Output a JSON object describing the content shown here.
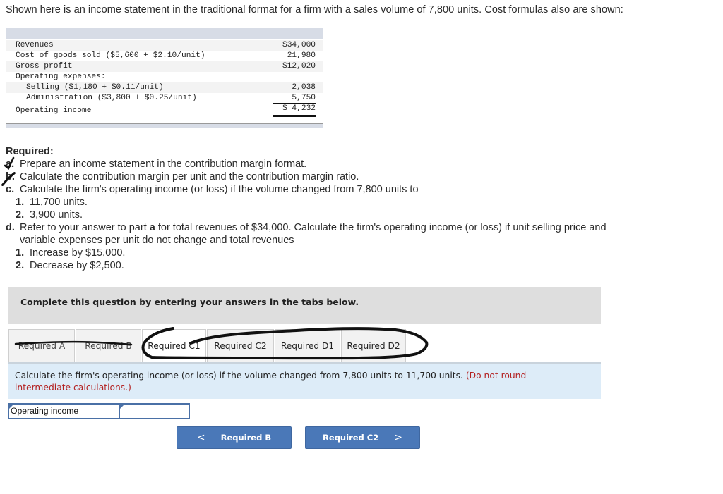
{
  "intro": "Shown here is an income statement in the traditional format for a firm with a sales volume of 7,800 units. Cost formulas also are shown:",
  "statement": {
    "rows": [
      {
        "label": "Revenues",
        "value": "$34,000"
      },
      {
        "label": "Cost of goods sold ($5,600 + $2.10/unit)",
        "value": "21,980"
      },
      {
        "label": "Gross profit",
        "value": "$12,020"
      },
      {
        "label": "Operating expenses:",
        "value": ""
      },
      {
        "label": "Selling ($1,180 + $0.11/unit)",
        "value": "2,038"
      },
      {
        "label": "Administration ($3,800 + $0.25/unit)",
        "value": "5,750"
      },
      {
        "label": "Operating income",
        "value": "$ 4,232"
      }
    ]
  },
  "required": {
    "title": "Required:",
    "items": [
      {
        "letter": "a.",
        "text": "Prepare an income statement in the contribution margin format.",
        "checked": true
      },
      {
        "letter": "b.",
        "text": "Calculate the contribution margin per unit and the contribution margin ratio.",
        "checked": true
      },
      {
        "letter": "c.",
        "text": "Calculate the firm's operating income (or loss) if the volume changed from 7,800 units to",
        "checked": false,
        "subs": [
          {
            "num": "1.",
            "text": "11,700 units."
          },
          {
            "num": "2.",
            "text": "3,900 units."
          }
        ]
      },
      {
        "letter": "d.",
        "text_before": "Refer to your answer to part ",
        "text_bold": "a",
        "text_after": " for total revenues of $34,000. Calculate the firm's operating income (or loss) if unit selling price and",
        "text_line2": "variable expenses per unit do not change and total revenues",
        "checked": false,
        "subs": [
          {
            "num": "1.",
            "text": "Increase by $15,000."
          },
          {
            "num": "2.",
            "text": "Decrease by $2,500."
          }
        ]
      }
    ]
  },
  "question_box": "Complete this question by entering your answers in the tabs below.",
  "tabs": [
    {
      "label": "Required A",
      "state": "done"
    },
    {
      "label": "Required B",
      "state": "done"
    },
    {
      "label": "Required C1",
      "state": "active"
    },
    {
      "label": "Required C2",
      "state": "normal"
    },
    {
      "label": "Required D1",
      "state": "normal"
    },
    {
      "label": "Required D2",
      "state": "normal"
    }
  ],
  "instruction": {
    "text": "Calculate the firm's operating income (or loss) if the volume changed from 7,800 units to 11,700 units.",
    "hint": "(Do not round intermediate calculations.)"
  },
  "answer": {
    "label": "Operating income",
    "value": ""
  },
  "nav": {
    "prev_label": "Required B",
    "next_label": "Required C2",
    "prev_icon": "chevron-left-icon",
    "next_icon": "chevron-right-icon"
  },
  "colors": {
    "button": "#4a78b8",
    "hint": "#b32121",
    "instruction_bg": "#ddecf8",
    "question_bg": "#dedede"
  }
}
